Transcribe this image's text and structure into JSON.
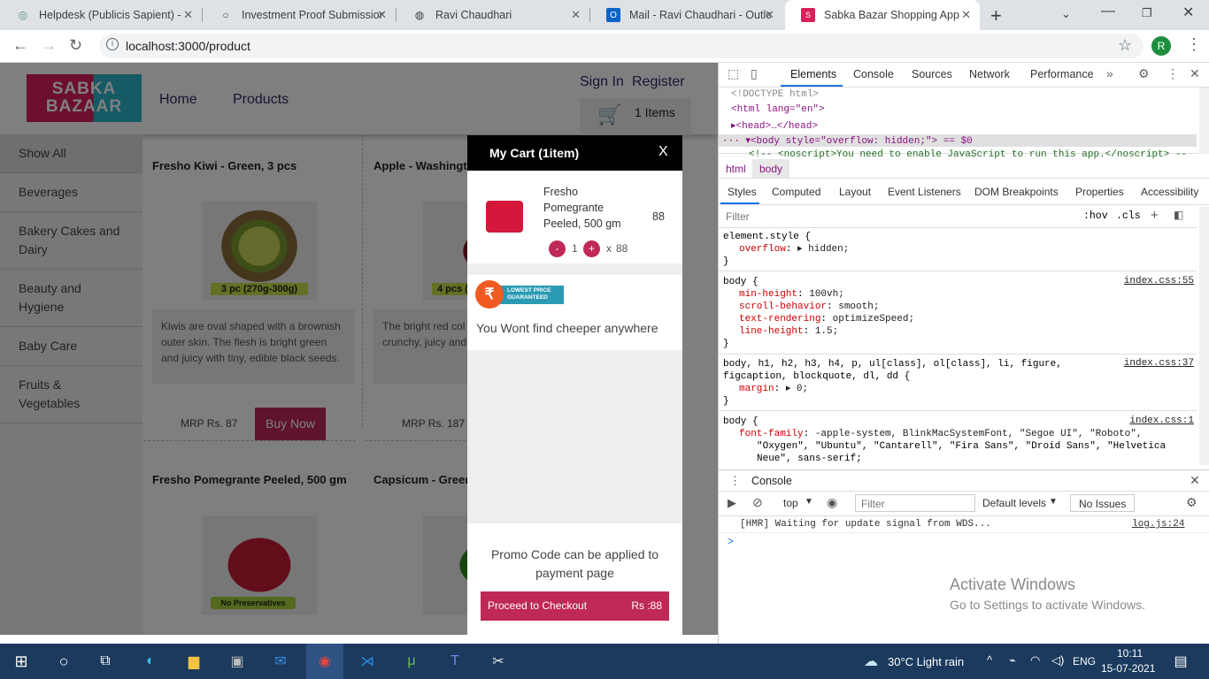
{
  "browser": {
    "tabs": [
      {
        "title": "Helpdesk (Publicis Sapient) - ",
        "icon": "helpdesk-icon"
      },
      {
        "title": "Investment Proof Submission",
        "icon": "circle-icon"
      },
      {
        "title": "Ravi Chaudhari",
        "icon": "globe-icon"
      },
      {
        "title": "Mail - Ravi Chaudhari - Outlo",
        "icon": "outlook-icon"
      },
      {
        "title": "Sabka Bazar Shopping App",
        "icon": "sabka-bazar-icon"
      }
    ],
    "url": "localhost:3000/product",
    "profile_initial": "R"
  },
  "app": {
    "logo_line1": "SABKA",
    "logo_line2": "BAZAAR",
    "nav": {
      "home": "Home",
      "products": "Products"
    },
    "auth": {
      "signin": "Sign In",
      "register": "Register"
    },
    "cart_button": "1 Items",
    "categories": [
      "Show All",
      "Beverages",
      "Bakery Cakes and Dairy",
      "Beauty and Hygiene",
      "Baby Care",
      "Fruits & Vegetables"
    ],
    "products": [
      {
        "name": "Fresho Kiwi - Green, 3 pcs",
        "image_label": "3 pc (270g-300g)",
        "desc": "Kiwis are oval shaped with a brownish outer skin. The flesh is bright green and juicy with tiny, edible black seeds.",
        "mrp": "MRP Rs. 87",
        "buy": "Buy Now"
      },
      {
        "name": "Apple - Washingt",
        "image_label": "4 pcs (5",
        "desc": "The bright red col shaped Washingto crunchy, juicy and Washington Apple",
        "mrp": "MRP Rs. 187"
      },
      {
        "name": "Fresho Pomegrante Peeled, 500 gm",
        "image_label": "No Preservatives"
      },
      {
        "name": "Capsicum - Green"
      }
    ]
  },
  "cart": {
    "title": "My Cart (1item)",
    "close": "X",
    "item": {
      "name": "Fresho Pomegrante Peeled, 500 gm",
      "price": "88",
      "minus": "-",
      "qty": "1",
      "plus": "+",
      "times": "x",
      "unit_price": "88"
    },
    "guarantee_badge": "LOWEST PRICE GUARANTEED",
    "guarantee_symbol": "₹",
    "guarantee_text": "You Wont find cheeper anywhere",
    "promo": "Promo Code can be applied to payment page",
    "checkout": "Proceed to Checkout",
    "checkout_total": "Rs :88"
  },
  "devtools": {
    "tabs": [
      "Elements",
      "Console",
      "Sources",
      "Network",
      "Performance"
    ],
    "dom": [
      "<!DOCTYPE html>",
      "<html lang=\"en\">",
      "▸<head>…</head>",
      "··· ▾<body style=\"overflow: hidden;\"> == $0",
      "<!-- <noscript>You need to enable JavaScript to run this app.</noscript> --"
    ],
    "breadcrumbs": [
      "html",
      "body"
    ],
    "subtabs": [
      "Styles",
      "Computed",
      "Layout",
      "Event Listeners",
      "DOM Breakpoints",
      "Properties",
      "Accessibility"
    ],
    "filter_placeholder": "Filter",
    "hov": ":hov",
    "cls": ".cls",
    "rules": [
      {
        "selector": "element.style {",
        "source": "",
        "props": [
          [
            "overflow",
            "▸ hidden;"
          ]
        ]
      },
      {
        "selector": "body {",
        "source": "index.css:55",
        "props": [
          [
            "min-height",
            "100vh;"
          ],
          [
            "scroll-behavior",
            "smooth;"
          ],
          [
            "text-rendering",
            "optimizeSpeed;"
          ],
          [
            "line-height",
            "1.5;"
          ]
        ]
      },
      {
        "selector": "body, h1, h2, h3, h4, p, ul[class], ol[class], li, figure,",
        "selector2": "figcaption, blockquote, dl, dd {",
        "source": "index.css:37",
        "props": [
          [
            "margin",
            "▸ 0;"
          ]
        ]
      },
      {
        "selector": "body {",
        "source": "index.css:1",
        "props": [
          [
            "font-family",
            "-apple-system, BlinkMacSystemFont, \"Segoe UI\", \"Roboto\","
          ]
        ],
        "cont": [
          "\"Oxygen\", \"Ubuntu\", \"Cantarell\", \"Fira Sans\", \"Droid Sans\", \"Helvetica",
          "Neue\", sans-serif;"
        ]
      }
    ],
    "console": {
      "title": "Console",
      "context": "top",
      "filter_placeholder": "Filter",
      "levels": "Default levels",
      "issues": "No Issues",
      "message": "[HMR] Waiting for update signal from WDS...",
      "message_source": "log.js:24",
      "prompt": ">"
    }
  },
  "watermark": {
    "line1": "Activate Windows",
    "line2": "Go to Settings to activate Windows."
  },
  "taskbar": {
    "weather": "30°C  Light rain",
    "lang": "ENG",
    "time": "10:11",
    "date": "15-07-2021"
  }
}
